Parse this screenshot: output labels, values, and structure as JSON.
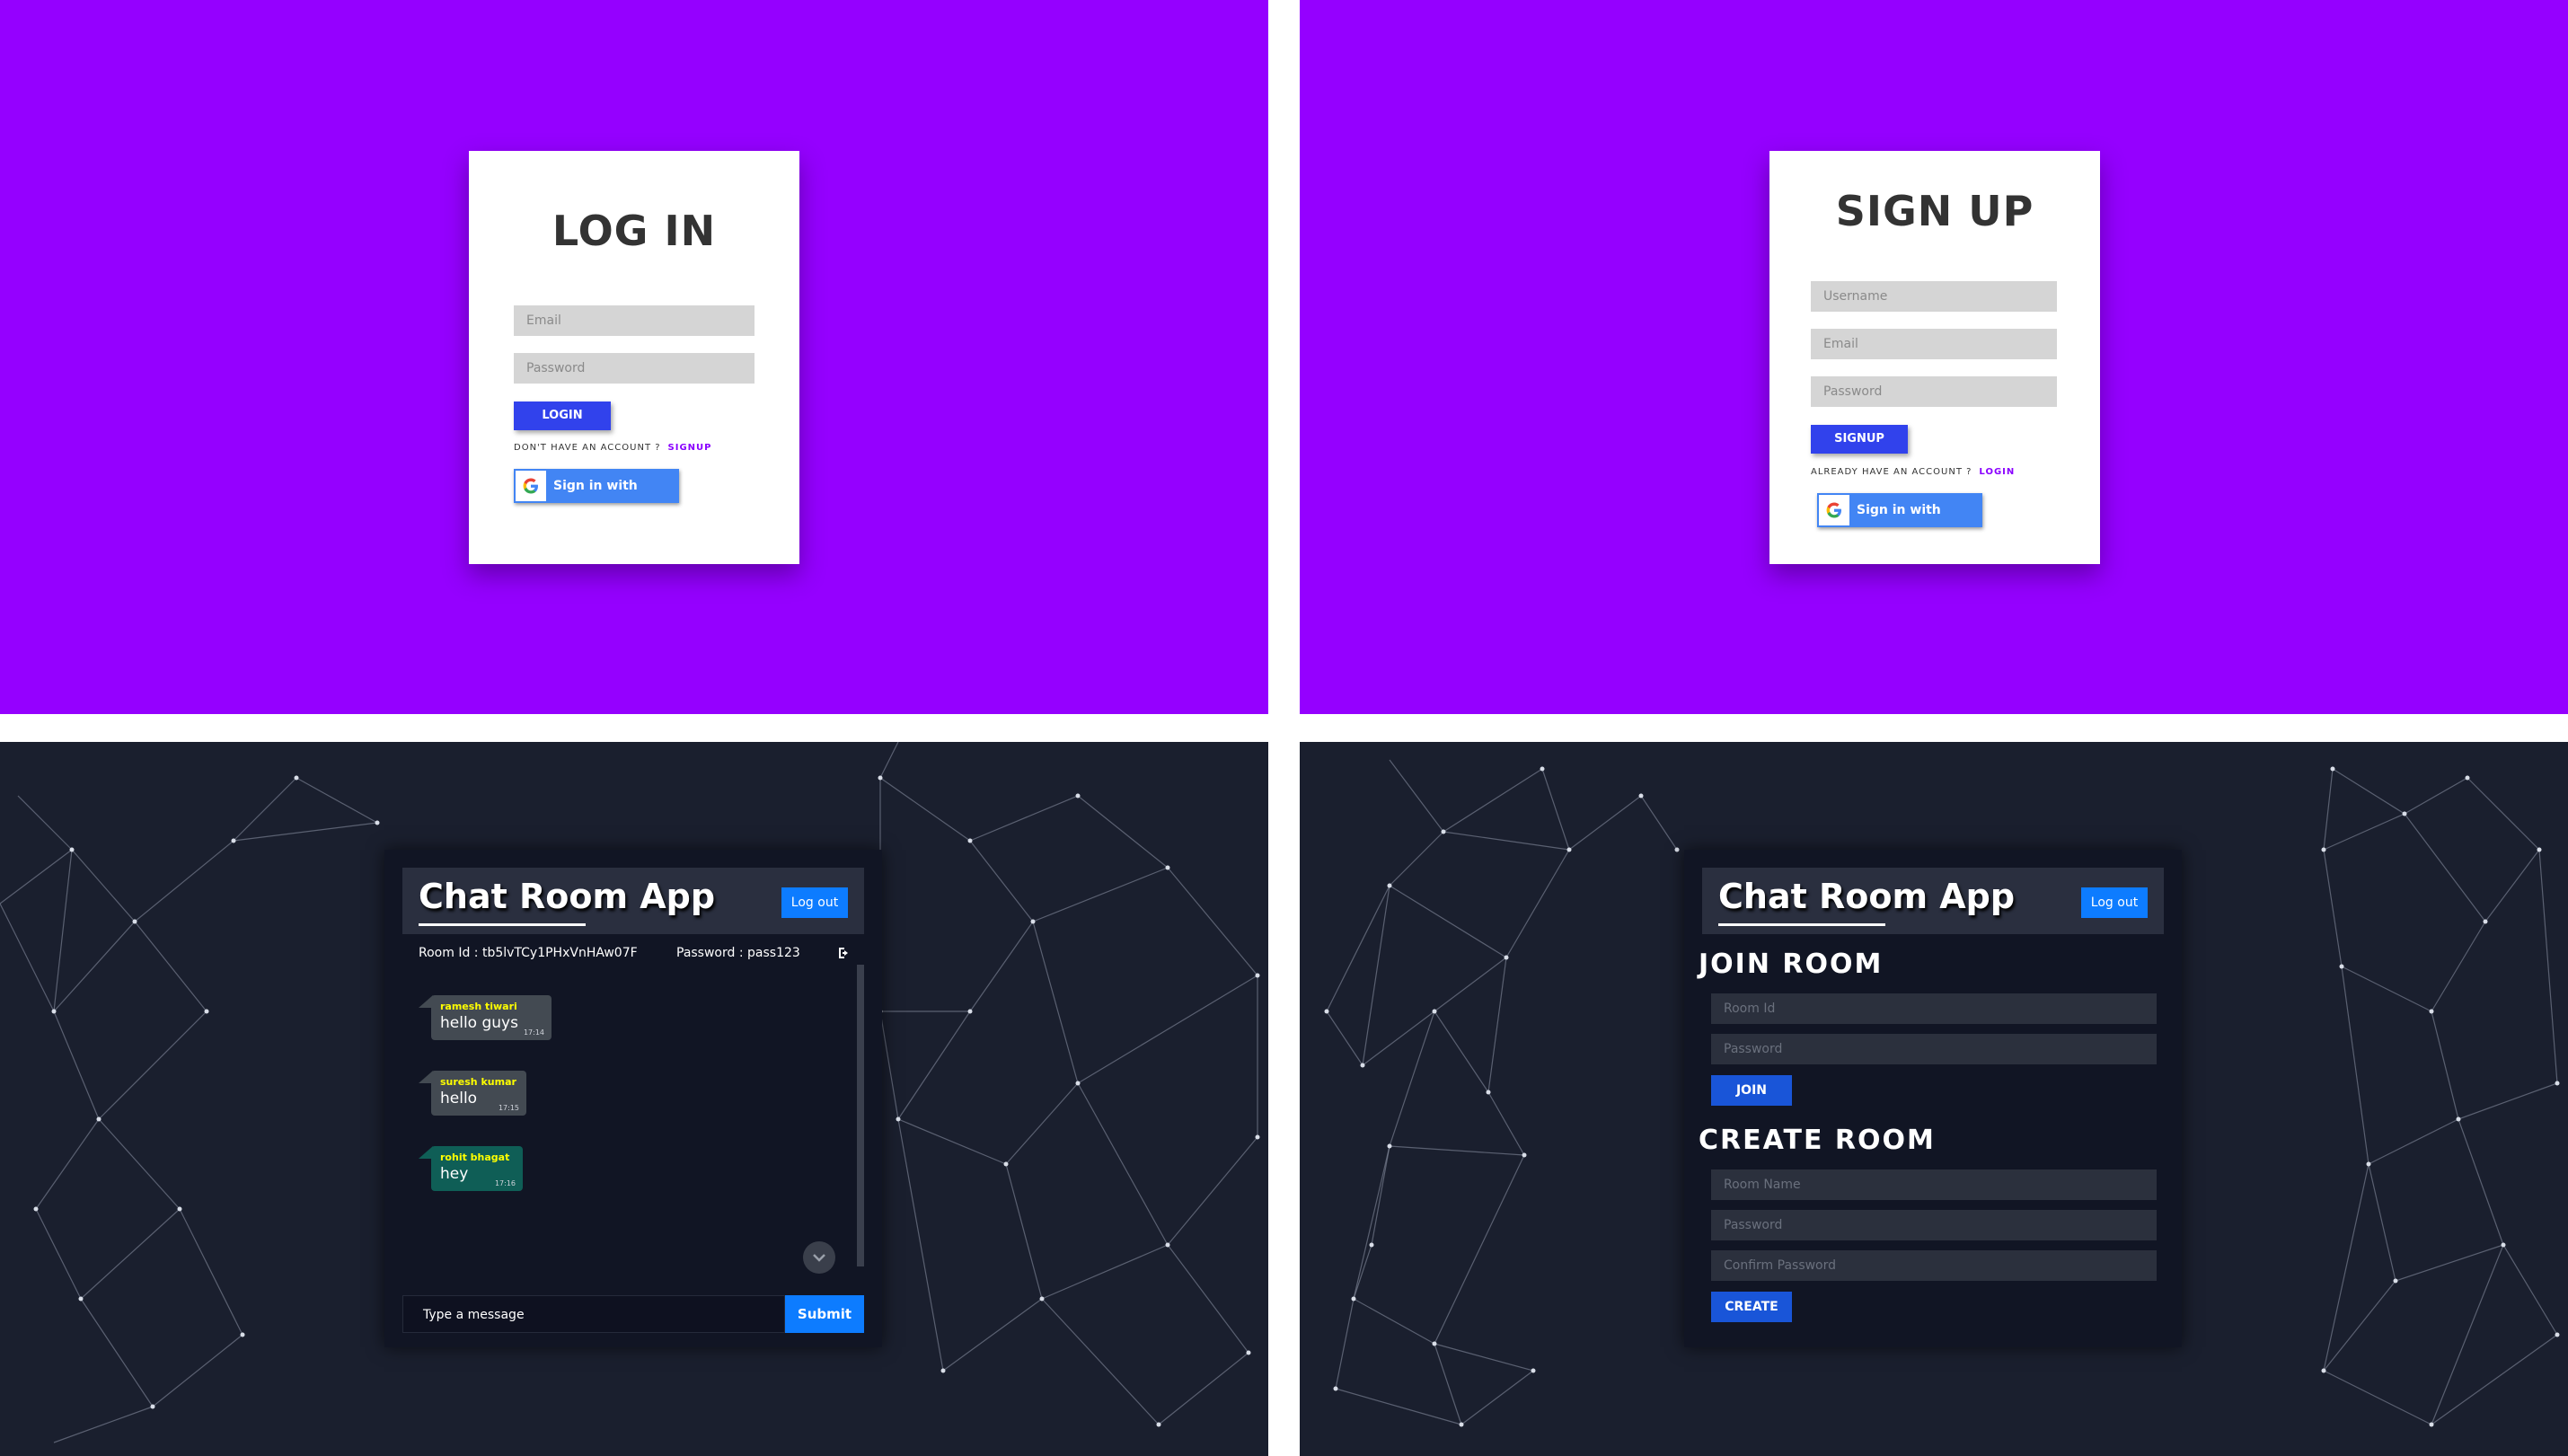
{
  "login": {
    "title": "LOG IN",
    "email_placeholder": "Email",
    "password_placeholder": "Password",
    "button": "LOGIN",
    "prompt": "DON'T HAVE AN ACCOUNT ?",
    "link": "SIGNUP",
    "google": "Sign in with google"
  },
  "signup": {
    "title": "SIGN UP",
    "username_placeholder": "Username",
    "email_placeholder": "Email",
    "password_placeholder": "Password",
    "button": "SIGNUP",
    "prompt": "ALREADY HAVE AN ACCOUNT ?",
    "link": "LOGIN",
    "google": "Sign in with google"
  },
  "chat": {
    "app_title": "Chat Room App",
    "logout": "Log out",
    "room_id": "Room Id : tb5lvTCy1PHxVnHAw07F",
    "password": "Password : pass123",
    "messages": [
      {
        "sender": "ramesh tiwari",
        "text": "hello guys",
        "time": "17:14"
      },
      {
        "sender": "suresh kumar",
        "text": "hello",
        "time": "17:15"
      },
      {
        "sender": "rohit bhagat",
        "text": "hey",
        "time": "17:16"
      }
    ],
    "message_placeholder": "Type a message",
    "submit": "Submit"
  },
  "rooms": {
    "app_title": "Chat Room App",
    "logout": "Log out",
    "join_heading": "JOIN ROOM",
    "join_room_id": "Room Id",
    "join_password": "Password",
    "join_button": "JOIN",
    "create_heading": "CREATE ROOM",
    "create_room_name": "Room Name",
    "create_password": "Password",
    "create_confirm": "Confirm Password",
    "create_button": "CREATE"
  },
  "colors": {
    "auth_bg": "#9500ff",
    "app_bg": "#1a1f2e",
    "primary_blue": "#3142ec",
    "link_purple": "#8a00ff",
    "sender_yellow": "#ffff00",
    "own_bubble": "#0f5e56",
    "other_bubble": "#434a52"
  },
  "icons": {
    "google": "google-g-icon",
    "leave": "exit-door-icon",
    "scroll": "chevron-down-icon"
  }
}
